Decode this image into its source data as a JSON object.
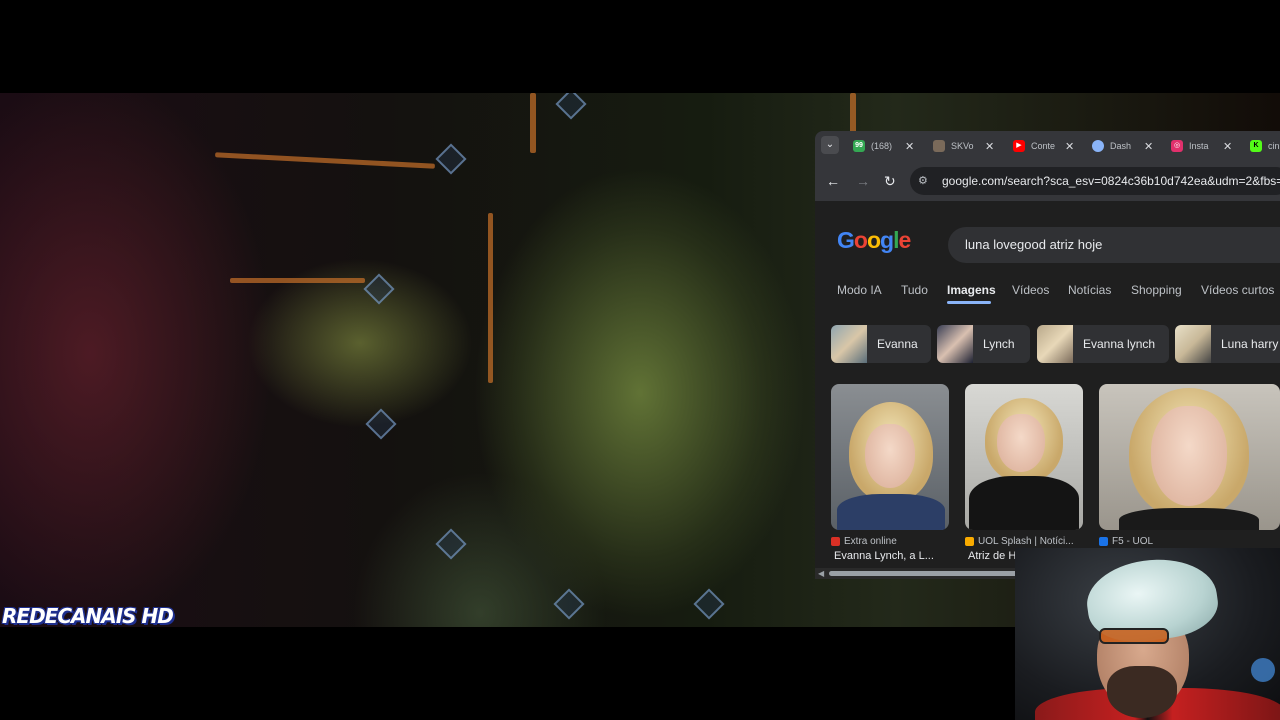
{
  "stream": {
    "watermark": "REDECANAIS HD"
  },
  "browser": {
    "tabs": [
      {
        "title": "(168)",
        "icon": "notification-count-icon",
        "color": "#34a853"
      },
      {
        "title": "SKVo",
        "icon": "profile-thumb-icon",
        "color": "#7a6a5a"
      },
      {
        "title": "Conte",
        "icon": "youtube-icon",
        "color": "#ff0000"
      },
      {
        "title": "Dash",
        "icon": "dashboard-icon",
        "color": "#8ab4f8"
      },
      {
        "title": "Insta",
        "icon": "instagram-icon",
        "color": "#e1306c"
      },
      {
        "title": "cin",
        "icon": "kick-icon",
        "color": "#53fc18"
      }
    ],
    "url": "google.com/search?sca_esv=0824c36b10d742ea&udm=2&fbs=AIJ",
    "page": {
      "logo": [
        "G",
        "o",
        "o",
        "g",
        "l",
        "e"
      ],
      "query": "luna lovegood atriz hoje",
      "search_tabs": [
        "Modo IA",
        "Tudo",
        "Imagens",
        "Vídeos",
        "Notícias",
        "Shopping",
        "Vídeos curtos"
      ],
      "active_tab": "Imagens",
      "chips": [
        "Evanna",
        "Lynch",
        "Evanna lynch",
        "Luna harry"
      ],
      "results": [
        {
          "source": "Extra online",
          "title": "Evanna Lynch, a L...",
          "source_color": "#d93025"
        },
        {
          "source": "UOL Splash | Notíci...",
          "title": "Atriz de H",
          "source_color": "#f9ab00"
        },
        {
          "source": "F5 - UOL",
          "title": "",
          "source_color": "#1a73e8"
        }
      ]
    }
  }
}
